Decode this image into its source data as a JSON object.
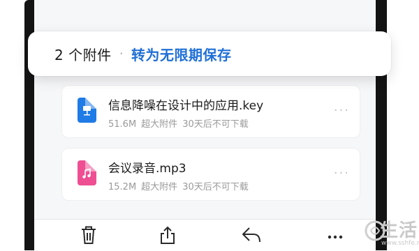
{
  "header": {
    "attachment_count": "2 个附件",
    "separator": "·",
    "convert_link": "转为无限期保存"
  },
  "files": [
    {
      "name": "信息降噪在设计中的应用.key",
      "size": "51.6M",
      "type_label": "超大附件",
      "expiry": "30天后不可下载",
      "icon": "keynote-file-icon",
      "icon_color": "#1f7be5"
    },
    {
      "name": "会议录音.mp3",
      "size": "15.2M",
      "type_label": "超大附件",
      "expiry": "30天后不可下载",
      "icon": "audio-file-icon",
      "icon_color": "#ee4f93"
    }
  ],
  "more_glyph": "···",
  "toolbar": {
    "icons": [
      "trash-icon",
      "share-icon",
      "reply-icon",
      "more-icon"
    ]
  },
  "watermark": {
    "text": "生活",
    "url": "www.sshfe.net"
  },
  "colors": {
    "accent": "#1f6fd6"
  }
}
